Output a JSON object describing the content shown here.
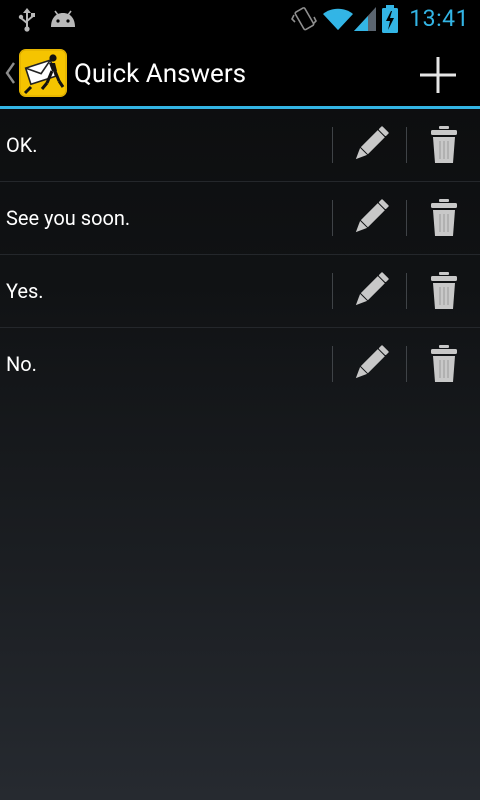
{
  "status_bar": {
    "time": "13:41",
    "icons": [
      "usb-icon",
      "android-debug-icon",
      "vibrate-icon",
      "wifi-icon",
      "signal-icon",
      "battery-charging-icon"
    ],
    "accent_color": "#33b5e5"
  },
  "action_bar": {
    "title": "Quick Answers",
    "up_icon": "chevron-left-icon",
    "logo_icon": "app-logo-icon",
    "add_icon": "plus-icon"
  },
  "quick_answers": [
    {
      "text": "OK."
    },
    {
      "text": "See you soon."
    },
    {
      "text": "Yes."
    },
    {
      "text": "No."
    }
  ],
  "row_actions": {
    "edit_icon": "pencil-icon",
    "delete_icon": "trash-icon"
  }
}
